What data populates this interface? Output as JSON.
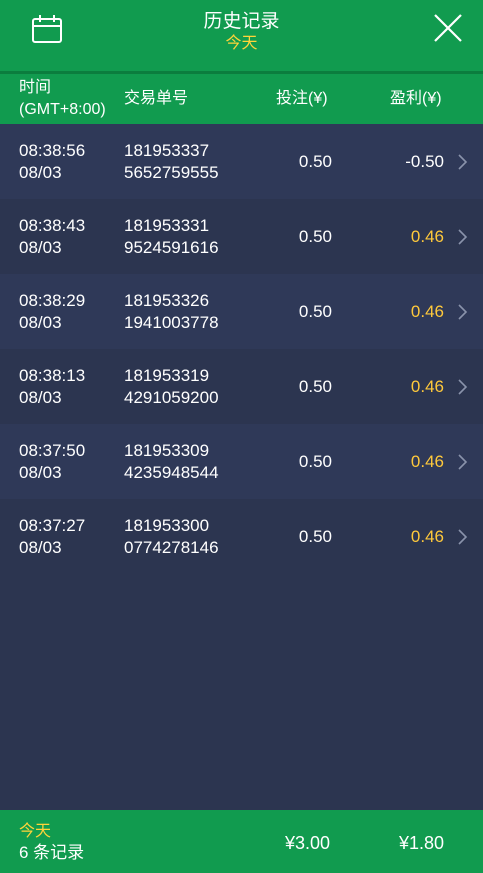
{
  "header": {
    "title": "历史记录",
    "subtitle": "今天",
    "calendar_icon": "calendar-icon",
    "close_icon": "close-icon"
  },
  "columns": {
    "time_line1": "时间",
    "time_line2": "(GMT+8:00)",
    "order": "交易单号",
    "bet": "投注(¥)",
    "profit": "盈利(¥)"
  },
  "rows": [
    {
      "time": "08:38:56",
      "date": "08/03",
      "order1": "181953337",
      "order2": "5652759555",
      "bet": "0.50",
      "profit": "-0.50"
    },
    {
      "time": "08:38:43",
      "date": "08/03",
      "order1": "181953331",
      "order2": "9524591616",
      "bet": "0.50",
      "profit": "0.46"
    },
    {
      "time": "08:38:29",
      "date": "08/03",
      "order1": "181953326",
      "order2": "1941003778",
      "bet": "0.50",
      "profit": "0.46"
    },
    {
      "time": "08:38:13",
      "date": "08/03",
      "order1": "181953319",
      "order2": "4291059200",
      "bet": "0.50",
      "profit": "0.46"
    },
    {
      "time": "08:37:50",
      "date": "08/03",
      "order1": "181953309",
      "order2": "4235948544",
      "bet": "0.50",
      "profit": "0.46"
    },
    {
      "time": "08:37:27",
      "date": "08/03",
      "order1": "181953300",
      "order2": "0774278146",
      "bet": "0.50",
      "profit": "0.46"
    }
  ],
  "footer": {
    "period": "今天",
    "count": "6 条记录",
    "total_bet": "¥3.00",
    "total_profit": "¥1.80"
  },
  "colors": {
    "header_green": "#119b4f",
    "background": "#2c3550",
    "accent_yellow": "#ffd43a",
    "positive_profit": "#ffc93b"
  }
}
